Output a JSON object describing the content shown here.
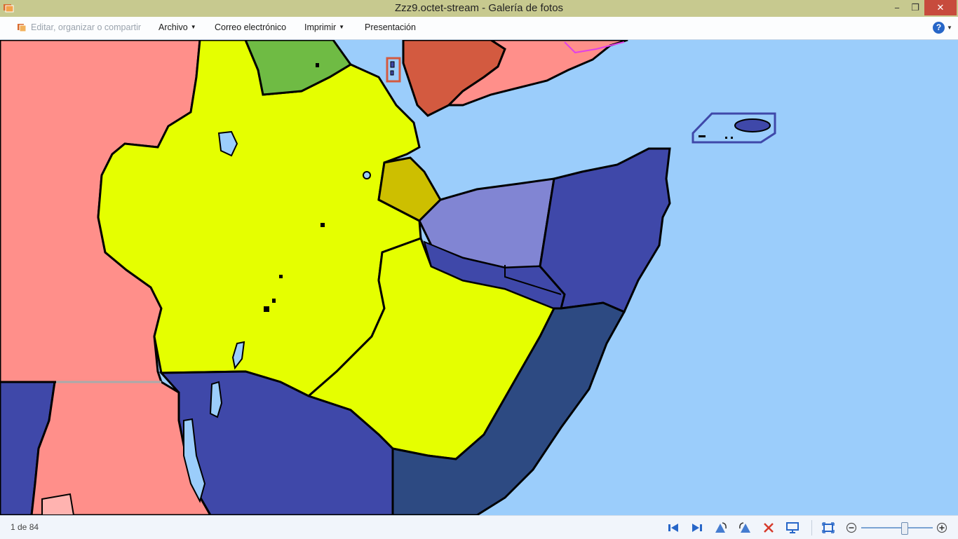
{
  "window": {
    "title": "Zzz9.octet-stream - Galería de fotos",
    "controls": {
      "minimize": "−",
      "maximize": "❐",
      "close": "✕"
    }
  },
  "menu": {
    "edit": "Editar, organizar o compartir",
    "file": "Archivo",
    "email": "Correo electrónico",
    "print": "Imprimir",
    "slideshow": "Presentación",
    "help": "?"
  },
  "status": {
    "counter": "1 de 84"
  },
  "zoom": {
    "level": 0.62
  },
  "colors": {
    "water": "#9bcdfb",
    "pink": "#ff8f8a",
    "yellow": "#e5ff00",
    "green": "#6fbb44",
    "olive": "#cdbf00",
    "lavender": "#8185d3",
    "navy": "#3f48a9",
    "dark_navy": "#2d4a82",
    "brown": "#d35a40",
    "accent": "#2766c8",
    "close": "#c74b3d"
  }
}
